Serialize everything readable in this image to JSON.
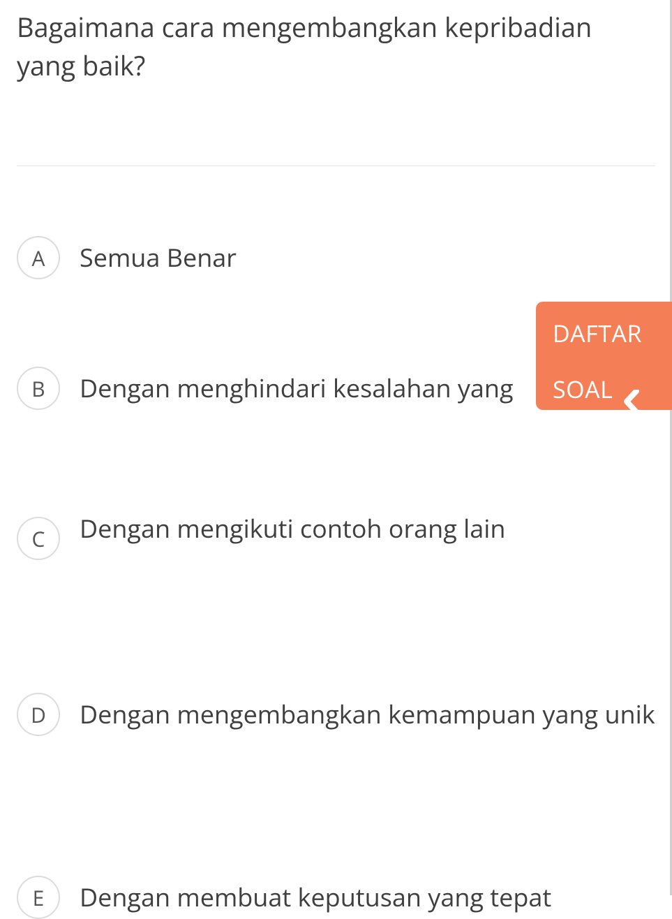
{
  "question": "Bagaimana cara mengembangkan kepribadian yang baik?",
  "options": [
    {
      "letter": "A",
      "text": "Semua Benar"
    },
    {
      "letter": "B",
      "text": "Dengan menghindari kesalahan yang"
    },
    {
      "letter": "C",
      "text": "Dengan mengikuti contoh orang lain"
    },
    {
      "letter": "D",
      "text": "Dengan mengembangkan kemampuan yang unik"
    },
    {
      "letter": "E",
      "text": "Dengan membuat keputusan yang tepat"
    }
  ],
  "floatTab": {
    "line1": "DAFTAR",
    "line2": "SOAL"
  }
}
